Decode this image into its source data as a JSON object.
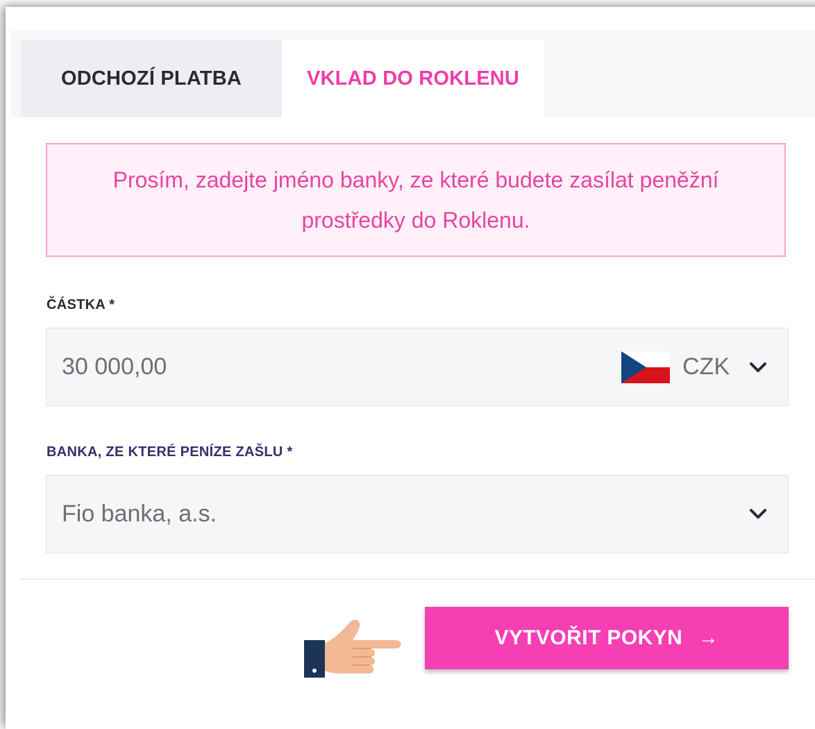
{
  "tabs": [
    {
      "label": "ODCHOZÍ PLATBA",
      "active": false
    },
    {
      "label": "VKLAD DO ROKLENU",
      "active": true
    }
  ],
  "alert": {
    "line1": "Prosím, zadejte jméno banky, ze které budete zasílat peněžní",
    "line2": "prostředky do Roklenu."
  },
  "amount": {
    "label": "ČÁSTKA *",
    "value": "30 000,00",
    "currency": "CZK",
    "currency_flag_icon": "czech-flag-icon"
  },
  "bank": {
    "label": "BANKA, ZE KTERÉ PENÍZE ZAŠLU *",
    "value": "Fio banka, a.s."
  },
  "submit": {
    "label": "VYTVOŘIT POKYN",
    "arrow": "→"
  },
  "colors": {
    "accent": "#f53fb3",
    "accent_text": "#f03ca6",
    "alert_bg": "#fff0fa",
    "alert_border": "#f5a3d2",
    "field_bg": "#f5f6f7"
  }
}
